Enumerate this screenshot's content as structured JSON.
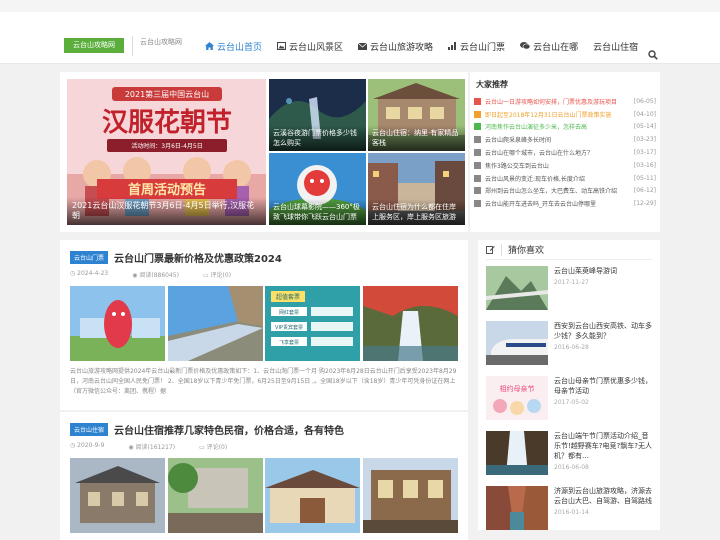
{
  "header": {
    "logo": "云台山攻略网",
    "slogan": "云台山攻略网",
    "nav": [
      {
        "label": "云台山首页",
        "icon": "home-icon",
        "active": true
      },
      {
        "label": "云台山风景区",
        "icon": "image-icon",
        "active": false
      },
      {
        "label": "云台山旅游攻略",
        "icon": "envelope-icon",
        "active": false
      },
      {
        "label": "云台山门票",
        "icon": "bar-chart-icon",
        "active": false
      },
      {
        "label": "云台山在哪",
        "icon": "chat-icon",
        "active": false
      },
      {
        "label": "云台山住宿",
        "icon": "",
        "active": false
      }
    ]
  },
  "slider": {
    "big": {
      "banner_top": "2021第三届中国云台山",
      "banner_main": "汉服花朝节",
      "banner_date": "活动时间：3月6日-4月5日",
      "banner_sub": "首周活动预告",
      "caption": "2021云台山汉服花朝节3月6日-4月5日举行,汉服花朝"
    },
    "small": [
      {
        "caption": "云溪谷夜游门票价格多少钱怎么购买"
      },
      {
        "caption": "云台山住宿：纳里·有家精品客栈"
      },
      {
        "caption": "云台山球幕影院——360°极致飞球带你飞跃云台山门票"
      },
      {
        "caption": "云台山住宿为什么都在住岸上服务区，岸上服务区旅游"
      }
    ]
  },
  "recommend": {
    "title": "大家推荐",
    "items": [
      {
        "text": "云台山一日游攻略如何安排，门票优惠及游玩项目",
        "date": "[06-05]",
        "color": "#e8534c"
      },
      {
        "text": "即日起至2018年12月31日云台山门票政策实施",
        "date": "[04-10]",
        "color": "#f0a02c"
      },
      {
        "text": "河南焦作云台山演征多少米，怎样去高",
        "date": "[05-14]",
        "color": "#4cb94c"
      },
      {
        "text": "云台山爬采泉峰多长时间",
        "date": "[03-23]",
        "color": "#888888"
      },
      {
        "text": "云台山在哪个城市，云台山在什么地方？",
        "date": "[03-17]",
        "color": "#888888"
      },
      {
        "text": "焦作3路公交车到云台山",
        "date": "[03-16]",
        "color": "#888888"
      },
      {
        "text": "云台山风景的变迁:现车价格,长度介绍",
        "date": "[05-11]",
        "color": "#888888"
      },
      {
        "text": "郑州到云台山怎么坐车，大巴费车、动车高铁介绍",
        "date": "[06-12]",
        "color": "#888888"
      },
      {
        "text": "云台山能开车进去吗_开车去云台山停哪里",
        "date": "[12-29]",
        "color": "#888888"
      }
    ]
  },
  "articles": [
    {
      "tag": "云台山门票",
      "title": "云台山门票最新价格及优惠政策2024",
      "date": "2024-4-23",
      "views": "阅读(886045)",
      "comments": "评论(0)",
      "panel_head": "超值套票",
      "panel_rows": [
        "网红套票",
        "VIP贵宾套票",
        "飞享套票"
      ],
      "excerpt": "云台山旅游攻略网提供2024年云台山最新门票价格及优惠政策如下：1、云台山淘门票一个月 购2023年8月28日云台山开门后享受2023年8月29日，河南云台山同全国人民免门票！ 2、全国18岁以下青少年免门票，6月25日至9月15日 ,。全国18岁以下（含18岁）青少年可凭身份证在网上（官方微信公众号：离团、携程）据"
    },
    {
      "tag": "云台山住宿",
      "title": "云台山住宿推荐几家特色民宿，价格合适，各有特色",
      "date": "2020-9-9",
      "views": "阅读(161217)",
      "comments": "评论(0)"
    }
  ],
  "guess": {
    "title": "猜你喜欢",
    "items": [
      {
        "title": "云台山茱萸峰导游词",
        "date": "2017-11-27"
      },
      {
        "title": "西安到云台山西安高铁、动车多少钱？多久能到？",
        "date": "2016-06-28"
      },
      {
        "title": "云台山母亲节门票优惠多少钱，母亲节活动",
        "date": "2017-05-02",
        "banner": "相约母亲节"
      },
      {
        "title": "云台山端午节门票活动介绍_音乐节!越野赛车?电竞?飘车?无人机？都有…",
        "date": "2016-06-08"
      },
      {
        "title": "济源到云台山旅游攻略，济源去云台山大巴、自驾游、自驾路线",
        "date": "2016-01-14"
      }
    ]
  }
}
